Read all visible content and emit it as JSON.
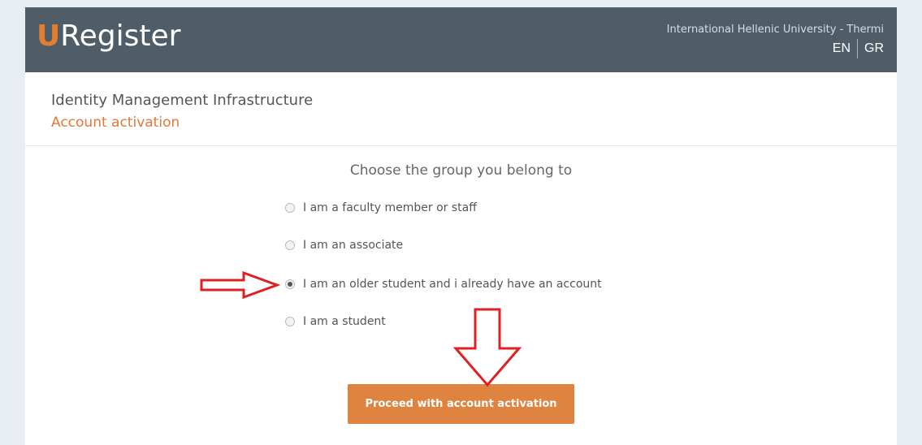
{
  "header": {
    "logo_letter": "U",
    "logo_text": "Register",
    "institution": "International Hellenic University - Thermi",
    "languages": [
      "EN",
      "GR"
    ]
  },
  "page": {
    "title": "Identity Management Infrastructure",
    "subtitle": "Account activation"
  },
  "form": {
    "prompt": "Choose the group you belong to",
    "options": [
      {
        "label": "I am a faculty member or staff",
        "checked": false
      },
      {
        "label": "I am an associate",
        "checked": false
      },
      {
        "label": "I am an older student and i already have an account",
        "checked": true
      },
      {
        "label": "I am a student",
        "checked": false
      }
    ],
    "submit_label": "Proceed with account activation"
  },
  "colors": {
    "header_bg": "#4f5d69",
    "accent": "#e0783a",
    "button": "#de8440",
    "annotation_arrow": "#e02020"
  },
  "annotations": [
    "right-arrow-icon",
    "down-arrow-icon"
  ]
}
